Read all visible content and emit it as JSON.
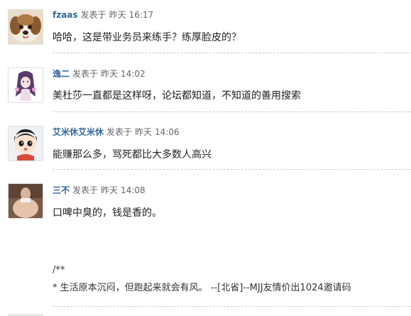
{
  "posts": [
    {
      "author": "fzaas",
      "posted_label": "发表于",
      "day": "昨天",
      "time": "16:17",
      "avatar_icon": "dog-avatar",
      "content": "哈哈，这是带业务员来练手？练厚脸皮的？"
    },
    {
      "author": "逸二",
      "posted_label": "发表于",
      "day": "昨天",
      "time": "14:02",
      "avatar_icon": "anime-girl-avatar",
      "content": "美杜莎一直都是这样呀，论坛都知道，不知道的善用搜索"
    },
    {
      "author": "艾米休艾米休",
      "posted_label": "发表于",
      "day": "昨天",
      "time": "14:06",
      "avatar_icon": "cartoon-kid-avatar",
      "content": "能赚那么多，骂死都比大多数人高兴"
    },
    {
      "author": "三不",
      "posted_label": "发表于",
      "day": "昨天",
      "time": "14:08",
      "avatar_icon": "photo-avatar",
      "content": "口啤中臭的，钱是香的。"
    }
  ],
  "signature": {
    "line1": "/**",
    "line2": "* 生活原本沉闷，但跑起来就会有风。 --[北省]--MJJ友情价出1024邀请码"
  },
  "colors": {
    "author_link": "#336699",
    "divider": "#cdcdcd",
    "text": "#222222"
  }
}
